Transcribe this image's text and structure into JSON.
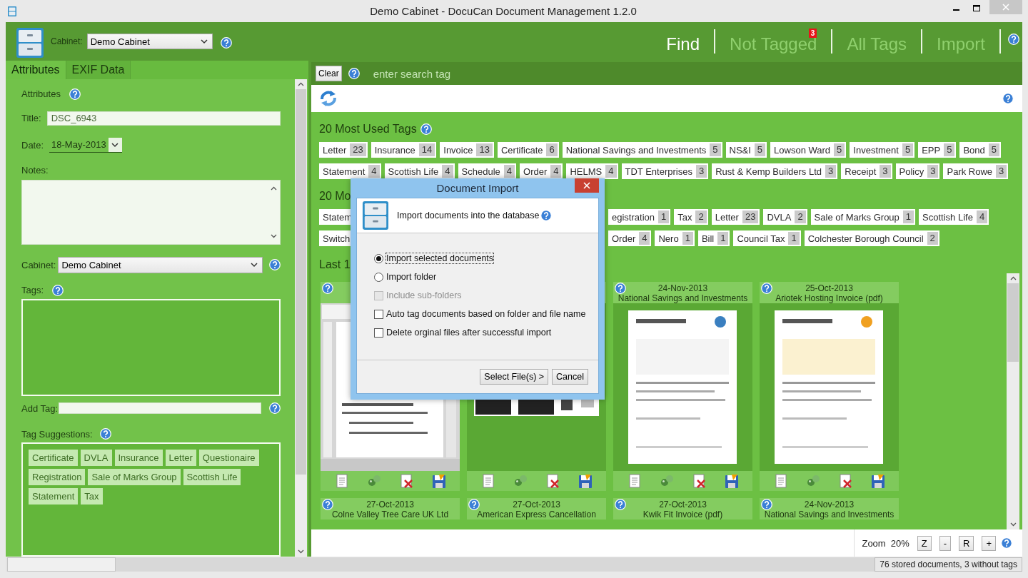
{
  "window": {
    "title": "Demo Cabinet - DocuCan Document Management 1.2.0"
  },
  "header": {
    "cabinet_label": "Cabinet:",
    "cabinet": "Demo Cabinet",
    "nav": [
      {
        "label": "Find",
        "selected": true
      },
      {
        "label": "Not Tagged",
        "selected": false,
        "badge": "3"
      },
      {
        "label": "All Tags",
        "selected": false
      },
      {
        "label": "Import",
        "selected": false
      }
    ]
  },
  "sidebar": {
    "tabs": [
      {
        "label": "Attributes",
        "selected": true
      },
      {
        "label": "EXIF Data",
        "selected": false
      }
    ],
    "heading": "Attributes",
    "title_label": "Title:",
    "title": "DSC_6943",
    "date_label": "Date:",
    "date": "18-May-2013",
    "notes_label": "Notes:",
    "cabinet_label": "Cabinet:",
    "cabinet": "Demo Cabinet",
    "tags_label": "Tags:",
    "add_tag_label": "Add Tag:",
    "suggestions_label": "Tag Suggestions:",
    "suggestions": [
      "Certificate",
      "DVLA",
      "Insurance",
      "Letter",
      "Questionaire",
      "Registration",
      "Sale of Marks Group",
      "Scottish Life",
      "Statement",
      "Tax"
    ]
  },
  "search": {
    "clear": "Clear",
    "placeholder": "enter search tag"
  },
  "tag_sections": [
    {
      "heading": "20 Most Used Tags",
      "rows": [
        {
          "tags": [
            {
              "label": "Letter",
              "count": "23"
            },
            {
              "label": "Insurance",
              "count": "14"
            },
            {
              "label": "Invoice",
              "count": "13"
            },
            {
              "label": "Certificate",
              "count": "6"
            },
            {
              "label": "National Savings and Investments",
              "count": "5"
            },
            {
              "label": "NS&I",
              "count": "5"
            },
            {
              "label": "Lowson Ward",
              "count": "5"
            },
            {
              "label": "Investment",
              "count": "5"
            },
            {
              "label": "EPP",
              "count": "5"
            },
            {
              "label": "Bond",
              "count": "5"
            }
          ]
        },
        {
          "tags": [
            {
              "label": "Statement",
              "count": "4"
            },
            {
              "label": "Scottish Life",
              "count": "4"
            },
            {
              "label": "Schedule",
              "count": "4"
            },
            {
              "label": "Order",
              "count": "4"
            },
            {
              "label": "HELMS",
              "count": "4"
            },
            {
              "label": "TDT Enterprises",
              "count": "3"
            },
            {
              "label": "Rust & Kemp Builders Ltd",
              "count": "3"
            },
            {
              "label": "Receipt",
              "count": "3"
            },
            {
              "label": "Policy",
              "count": "3"
            },
            {
              "label": "Park Rowe",
              "count": "3"
            }
          ]
        }
      ]
    },
    {
      "heading": "20 Mo",
      "rows": [
        {
          "tags": [
            {
              "label": "Statem"
            }
          ],
          "after_dialog": [
            {
              "label": "egistration",
              "count": "1"
            },
            {
              "label": "Tax",
              "count": "2"
            },
            {
              "label": "Letter",
              "count": "23"
            },
            {
              "label": "DVLA",
              "count": "2"
            },
            {
              "label": "Sale of Marks Group",
              "count": "1"
            },
            {
              "label": "Scottish Life",
              "count": "4"
            }
          ]
        },
        {
          "tags": [
            {
              "label": "Switch"
            }
          ],
          "after_dialog": [
            {
              "label": "Order",
              "count": "4"
            },
            {
              "label": "Nero",
              "count": "1"
            },
            {
              "label": "Bill",
              "count": "1"
            },
            {
              "label": "Council Tax",
              "count": "1"
            },
            {
              "label": "Colchester Borough Council",
              "count": "2"
            }
          ]
        }
      ]
    }
  ],
  "last_heading": "Last 1",
  "cards": [
    {
      "thumbnail": {
        "kind": "picture"
      }
    },
    {
      "thumbnail": {
        "kind": "picture"
      }
    },
    {
      "date": "24-Nov-2013",
      "title": "National Savings and Investments",
      "thumbnail": {
        "kind": "picture"
      }
    },
    {
      "date": "25-Oct-2013",
      "title": "Ariotek Hosting Invoice (pdf)",
      "thumbnail": {
        "kind": "picture"
      }
    },
    {
      "date": "27-Oct-2013",
      "title": "Colne Valley Tree Care UK Ltd"
    },
    {
      "date": "27-Oct-2013",
      "title": "American Express Cancellation"
    },
    {
      "date": "27-Oct-2013",
      "title": "Kwik Fit Invoice (pdf)"
    },
    {
      "date": "24-Nov-2013",
      "title": "National Savings and Investments"
    }
  ],
  "zoom": {
    "label": "Zoom",
    "value": "20%",
    "buttons": [
      "Z",
      "-",
      "R",
      "+"
    ]
  },
  "status_bar": {
    "text": "76 stored documents, 3 without tags"
  },
  "dialog": {
    "title": "Document Import",
    "heading": "Import documents into the database",
    "options": [
      {
        "kind": "radio",
        "label": "Import selected documents",
        "selected": true
      },
      {
        "kind": "radio",
        "label": "Import folder",
        "selected": false
      },
      {
        "kind": "checkbox",
        "label": "Include sub-folders",
        "checked": false,
        "disabled": true
      },
      {
        "kind": "checkbox",
        "label": "Auto tag documents based on folder and file name",
        "checked": false,
        "disabled": false
      },
      {
        "kind": "checkbox",
        "label": "Delete orginal files after successful import",
        "checked": false,
        "disabled": false
      }
    ],
    "buttons": [
      "Select File(s) >",
      "Cancel"
    ]
  }
}
